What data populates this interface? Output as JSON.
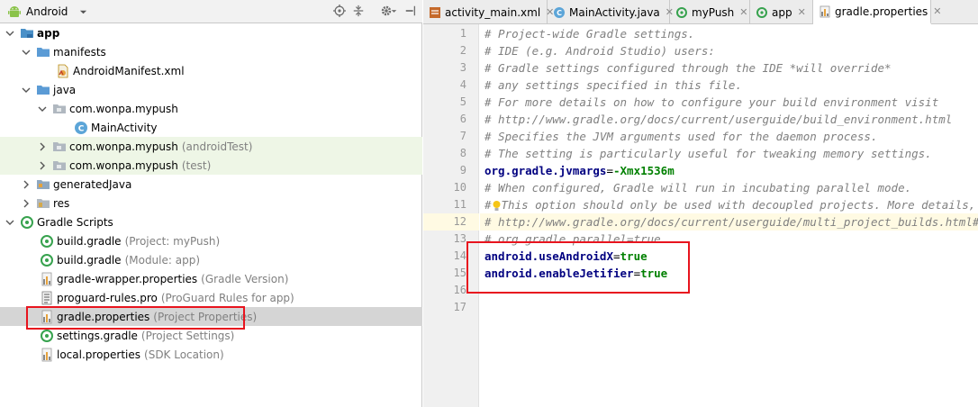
{
  "left_toolbar": {
    "view_label": "Android",
    "icons": [
      "android-icon",
      "dropdown-arrow-icon",
      "locate-icon",
      "collapse-all-icon",
      "settings-icon",
      "hide-icon"
    ]
  },
  "tree": {
    "app": "app",
    "manifests": "manifests",
    "android_manifest": "AndroidManifest.xml",
    "java": "java",
    "pkg_main": "com.wonpa.mypush",
    "main_activity": "MainActivity",
    "pkg_android_test": "com.wonpa.mypush",
    "pkg_android_test_hint": "(androidTest)",
    "pkg_test": "com.wonpa.mypush",
    "pkg_test_hint": "(test)",
    "generated_java": "generatedJava",
    "res": "res",
    "gradle_scripts": "Gradle Scripts",
    "build_gradle_project": "build.gradle",
    "build_gradle_project_hint": "(Project: myPush)",
    "build_gradle_module": "build.gradle",
    "build_gradle_module_hint": "(Module: app)",
    "gradle_wrapper": "gradle-wrapper.properties",
    "gradle_wrapper_hint": "(Gradle Version)",
    "proguard": "proguard-rules.pro",
    "proguard_hint": "(ProGuard Rules for app)",
    "gradle_properties": "gradle.properties",
    "gradle_properties_hint": "(Project Properties)",
    "settings_gradle": "settings.gradle",
    "settings_gradle_hint": "(Project Settings)",
    "local_properties": "local.properties",
    "local_properties_hint": "(SDK Location)"
  },
  "tabs": [
    {
      "label": "activity_main.xml",
      "active": false
    },
    {
      "label": "MainActivity.java",
      "active": false
    },
    {
      "label": "myPush",
      "active": false
    },
    {
      "label": "app",
      "active": false
    },
    {
      "label": "gradle.properties",
      "active": true
    }
  ],
  "editor": {
    "line_numbers": [
      "1",
      "2",
      "3",
      "4",
      "5",
      "6",
      "7",
      "8",
      "9",
      "10",
      "11",
      "12",
      "13",
      "14",
      "15",
      "16",
      "17"
    ],
    "current_line": "12",
    "lines": {
      "l1": "# Project-wide Gradle settings.",
      "l2": "# IDE (e.g. Android Studio) users:",
      "l3": "# Gradle settings configured through the IDE *will override*",
      "l4": "# any settings specified in this file.",
      "l5": "# For more details on how to configure your build environment visit",
      "l6": "# http://www.gradle.org/docs/current/userguide/build_environment.html",
      "l7": "# Specifies the JVM arguments used for the daemon process.",
      "l8": "# The setting is particularly useful for tweaking memory settings.",
      "l9_key": "org.gradle.jvmargs",
      "l9_eq": "=",
      "l9_val": "-Xmx1536m",
      "l10": "# When configured, Gradle will run in incubating parallel mode.",
      "l11_hash": "#",
      "l11_rest": "This option should only be used with decoupled projects. More details, visit",
      "l12": "# http://www.gradle.org/docs/current/userguide/multi_project_builds.html#sec:decoupled_projects",
      "l13": "# org.gradle.parallel=true",
      "l14_key": "android.useAndroidX",
      "l14_eq": "=",
      "l14_val": "true",
      "l15_key": "android.enableJetifier",
      "l15_eq": "=",
      "l15_val": "true"
    }
  },
  "colors": {
    "highlight_box": "#e8141e",
    "comment": "#808080",
    "key": "#000080",
    "value": "#008000",
    "green_row": "#eef6e6",
    "selected_row": "#d5d5d5"
  }
}
